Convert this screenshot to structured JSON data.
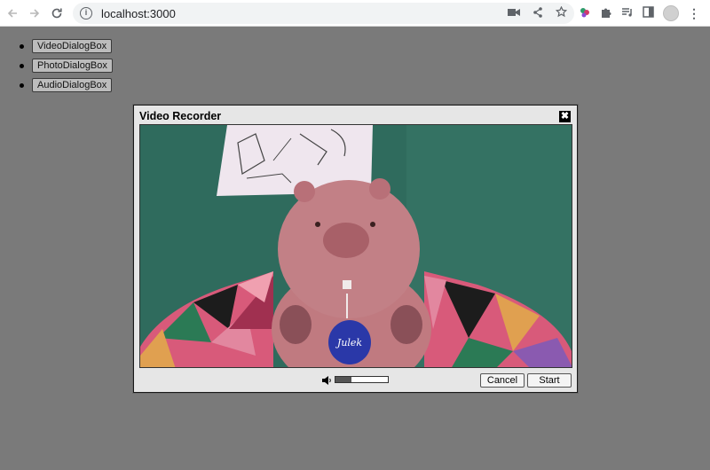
{
  "browser": {
    "url": "localhost:3000",
    "nav_icons": [
      "back-arrow-icon",
      "forward-arrow-icon",
      "reload-icon"
    ],
    "omnibox_icons": [
      "video-camera-icon",
      "share-icon",
      "bookmark-star-icon"
    ],
    "extension_icons": [
      "extension-colorful-icon",
      "puzzle-icon",
      "media-queue-icon",
      "side-panel-icon",
      "profile-avatar-icon",
      "more-menu-icon"
    ]
  },
  "page": {
    "buttons": [
      {
        "label": "VideoDialogBox"
      },
      {
        "label": "PhotoDialogBox"
      },
      {
        "label": "AudioDialogBox"
      }
    ]
  },
  "dialog": {
    "title": "Video Recorder",
    "close_glyph": "✖",
    "audio_level": 0.3,
    "cancel_label": "Cancel",
    "start_label": "Start",
    "video_badge_text": "Julek"
  },
  "colors": {
    "overlay": "#7a7a7a",
    "dialog_bg": "#e6e6e6",
    "wall": "#2f6b5d"
  }
}
